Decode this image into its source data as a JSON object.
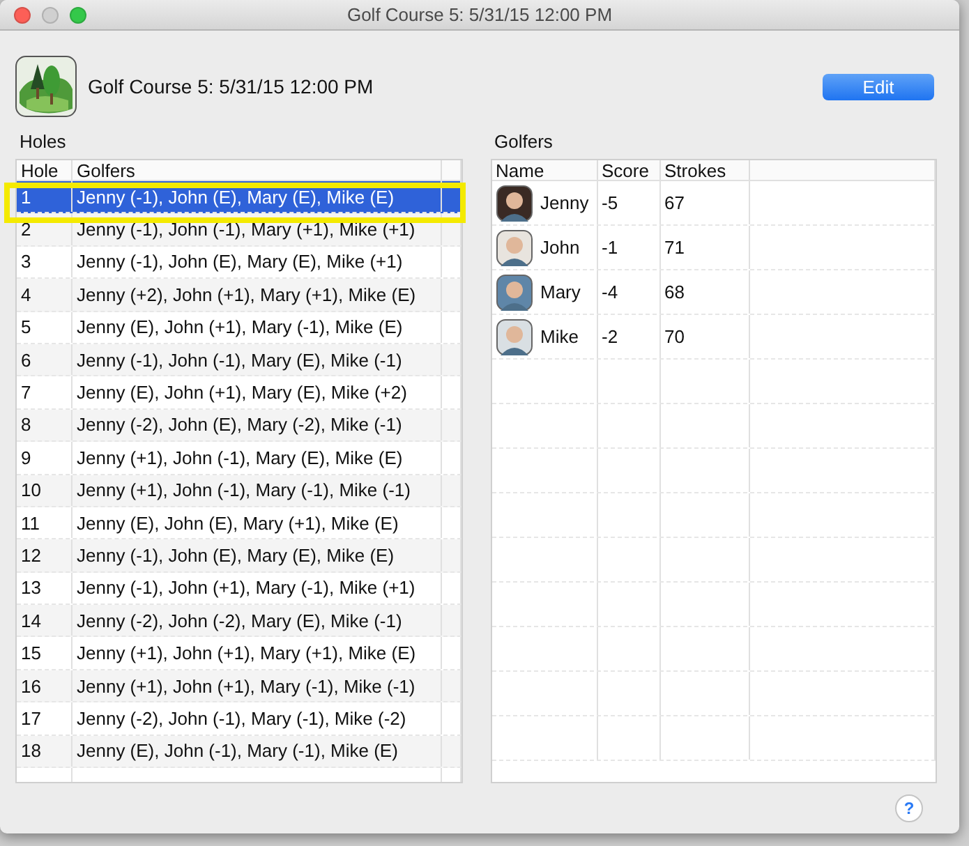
{
  "window": {
    "title": "Golf Course 5: 5/31/15 12:00 PM"
  },
  "header": {
    "title": "Golf Course 5: 5/31/15 12:00 PM",
    "edit_button": "Edit"
  },
  "holes": {
    "label": "Holes",
    "columns": [
      "Hole",
      "Golfers"
    ],
    "highlighted": true,
    "rows": [
      {
        "hole": "1",
        "golfers": "Jenny (-1), John (E), Mary (E), Mike (E)",
        "selected": true
      },
      {
        "hole": "2",
        "golfers": "Jenny (-1), John (-1), Mary (+1), Mike (+1)",
        "selected": false
      },
      {
        "hole": "3",
        "golfers": "Jenny (-1), John (E), Mary (E), Mike (+1)",
        "selected": false
      },
      {
        "hole": "4",
        "golfers": "Jenny (+2), John (+1), Mary (+1), Mike (E)",
        "selected": false
      },
      {
        "hole": "5",
        "golfers": "Jenny (E), John (+1), Mary (-1), Mike (E)",
        "selected": false
      },
      {
        "hole": "6",
        "golfers": "Jenny (-1), John (-1), Mary (E), Mike (-1)",
        "selected": false
      },
      {
        "hole": "7",
        "golfers": "Jenny (E), John (+1), Mary (E), Mike (+2)",
        "selected": false
      },
      {
        "hole": "8",
        "golfers": "Jenny (-2), John (E), Mary (-2), Mike (-1)",
        "selected": false
      },
      {
        "hole": "9",
        "golfers": "Jenny (+1), John (-1), Mary (E), Mike (E)",
        "selected": false
      },
      {
        "hole": "10",
        "golfers": "Jenny (+1), John (-1), Mary (-1), Mike (-1)",
        "selected": false
      },
      {
        "hole": "11",
        "golfers": "Jenny (E), John (E), Mary (+1), Mike (E)",
        "selected": false
      },
      {
        "hole": "12",
        "golfers": "Jenny (-1), John (E), Mary (E), Mike (E)",
        "selected": false
      },
      {
        "hole": "13",
        "golfers": "Jenny (-1), John (+1), Mary (-1), Mike (+1)",
        "selected": false
      },
      {
        "hole": "14",
        "golfers": "Jenny (-2), John (-2), Mary (E), Mike (-1)",
        "selected": false
      },
      {
        "hole": "15",
        "golfers": "Jenny (+1), John (+1), Mary (+1), Mike (E)",
        "selected": false
      },
      {
        "hole": "16",
        "golfers": "Jenny (+1), John (+1), Mary (-1), Mike (-1)",
        "selected": false
      },
      {
        "hole": "17",
        "golfers": "Jenny (-2), John (-1), Mary (-1), Mike (-2)",
        "selected": false
      },
      {
        "hole": "18",
        "golfers": "Jenny (E), John (-1), Mary (-1), Mike (E)",
        "selected": false
      }
    ]
  },
  "golfers": {
    "label": "Golfers",
    "columns": [
      "Name",
      "Score",
      "Strokes"
    ],
    "rows": [
      {
        "name": "Jenny",
        "score": "-5",
        "strokes": "67",
        "color": "#3a2a24"
      },
      {
        "name": "John",
        "score": "-1",
        "strokes": "71",
        "color": "#e8e4de"
      },
      {
        "name": "Mary",
        "score": "-4",
        "strokes": "68",
        "color": "#5f86a8"
      },
      {
        "name": "Mike",
        "score": "-2",
        "strokes": "70",
        "color": "#d9dfe3"
      }
    ]
  },
  "help_button": "?"
}
